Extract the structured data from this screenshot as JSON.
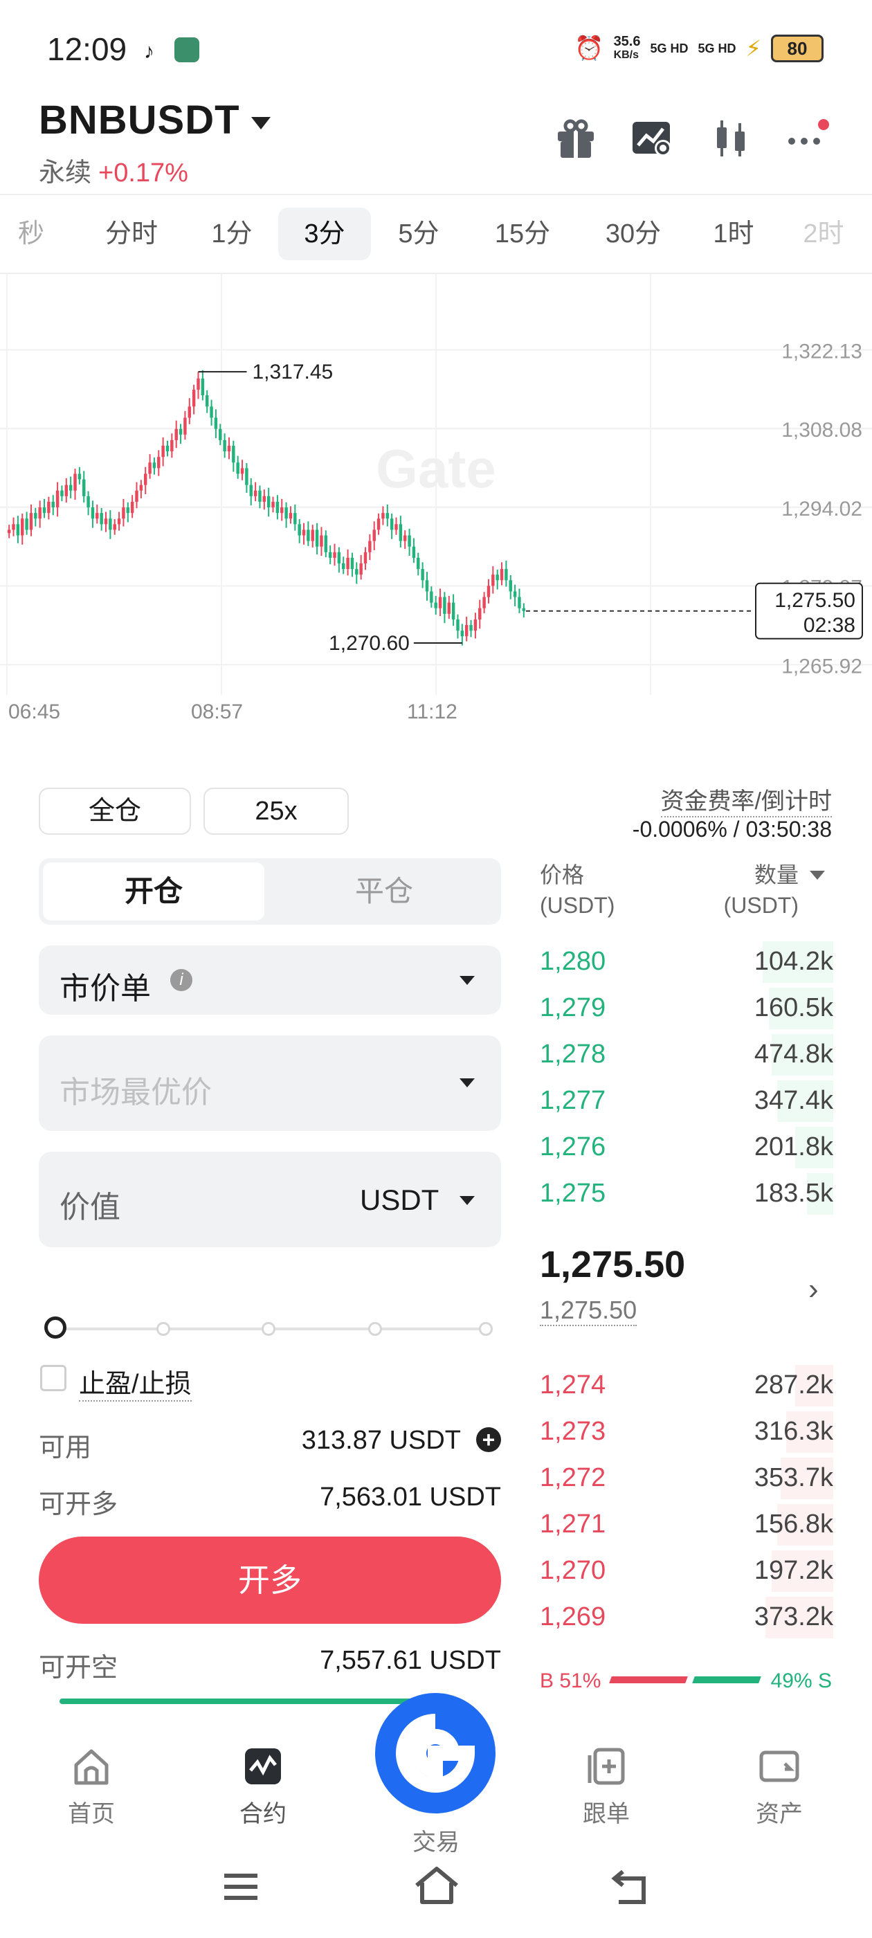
{
  "status_bar": {
    "time": "12:09",
    "net_speed": "35.6",
    "net_unit": "KB/s",
    "sig1": "5G HD",
    "sig2": "5G HD",
    "battery": "80"
  },
  "header": {
    "pair": "BNBUSDT",
    "contract_type": "永续",
    "change": "+0.17%"
  },
  "intervals": {
    "items": [
      "秒",
      "分时",
      "1分",
      "3分",
      "5分",
      "15分",
      "30分",
      "1时",
      "2时"
    ],
    "active": "3分"
  },
  "chart_data": {
    "type": "candlestick",
    "watermark": "Gate",
    "price_ticks": [
      "1,322.13",
      "1,308.08",
      "1,294.02",
      "1,279.97",
      "1,265.92"
    ],
    "time_ticks": [
      "06:45",
      "08:57",
      "11:12"
    ],
    "high_label": "1,317.45",
    "low_label": "1,270.60",
    "last_price": "1,275.50",
    "countdown": "02:38",
    "ylim": [
      1263,
      1326
    ],
    "closes": [
      1290,
      1291,
      1289,
      1292,
      1290,
      1293,
      1292,
      1294,
      1293,
      1295,
      1294,
      1297,
      1296,
      1298,
      1297,
      1300,
      1299,
      1296,
      1294,
      1292,
      1293,
      1291,
      1292,
      1290,
      1291,
      1292,
      1294,
      1293,
      1295,
      1297,
      1298,
      1300,
      1302,
      1301,
      1303,
      1305,
      1304,
      1306,
      1308,
      1307,
      1310,
      1312,
      1315,
      1317,
      1314,
      1312,
      1310,
      1308,
      1306,
      1304,
      1305,
      1302,
      1300,
      1301,
      1298,
      1296,
      1297,
      1295,
      1296,
      1294,
      1295,
      1293,
      1294,
      1292,
      1293,
      1291,
      1289,
      1290,
      1288,
      1290,
      1287,
      1289,
      1286,
      1285,
      1286,
      1284,
      1283,
      1285,
      1283,
      1282,
      1284,
      1286,
      1288,
      1290,
      1292,
      1293,
      1292,
      1290,
      1291,
      1288,
      1289,
      1287,
      1285,
      1283,
      1281,
      1279,
      1277,
      1276,
      1278,
      1275,
      1277,
      1274,
      1272,
      1271,
      1273,
      1272,
      1274,
      1276,
      1278,
      1280,
      1282,
      1281,
      1283,
      1281,
      1279,
      1278,
      1276,
      1275.5
    ]
  },
  "margin_mode": "全仓",
  "leverage": "25x",
  "funding": {
    "label": "资金费率/倒计时",
    "value": "-0.0006% / 03:50:38"
  },
  "order_tabs": {
    "open": "开仓",
    "close": "平仓"
  },
  "order_type": "市价单",
  "price_placeholder": "市场最优价",
  "amount": {
    "label": "价值",
    "unit": "USDT"
  },
  "slider_fraction": 0,
  "tpsl_label": "止盈/止损",
  "available": {
    "label": "可用",
    "value": "313.87",
    "unit": "USDT"
  },
  "can_long": {
    "label": "可开多",
    "value": "7,563.01 USDT"
  },
  "long_button": "开多",
  "can_short": {
    "label": "可开空",
    "value": "7,557.61 USDT"
  },
  "orderbook": {
    "price_header": "价格",
    "price_unit": "(USDT)",
    "qty_header": "数量",
    "qty_unit": "(USDT)",
    "asks": [
      {
        "price": "1,280",
        "qty": "104.2k",
        "depth": 0.24
      },
      {
        "price": "1,279",
        "qty": "160.5k",
        "depth": 0.22
      },
      {
        "price": "1,278",
        "qty": "474.8k",
        "depth": 0.21
      },
      {
        "price": "1,277",
        "qty": "347.4k",
        "depth": 0.19
      },
      {
        "price": "1,276",
        "qty": "201.8k",
        "depth": 0.13
      },
      {
        "price": "1,275",
        "qty": "183.5k",
        "depth": 0.09
      }
    ],
    "last": "1,275.50",
    "mark": "1,275.50",
    "bids": [
      {
        "price": "1,274",
        "qty": "287.2k",
        "depth": 0.13
      },
      {
        "price": "1,273",
        "qty": "316.3k",
        "depth": 0.16
      },
      {
        "price": "1,272",
        "qty": "353.7k",
        "depth": 0.18
      },
      {
        "price": "1,271",
        "qty": "156.8k",
        "depth": 0.19
      },
      {
        "price": "1,270",
        "qty": "197.2k",
        "depth": 0.21
      },
      {
        "price": "1,269",
        "qty": "373.2k",
        "depth": 0.23
      }
    ],
    "buy_ratio": "B 51%",
    "sell_ratio": "49% S"
  },
  "bottom_nav": [
    {
      "label": "首页"
    },
    {
      "label": "合约"
    },
    {
      "label": "交易"
    },
    {
      "label": "跟单"
    },
    {
      "label": "资产"
    }
  ],
  "colors": {
    "up": "#22b27c",
    "down": "#e8485b",
    "accent": "#1a6cf0"
  }
}
